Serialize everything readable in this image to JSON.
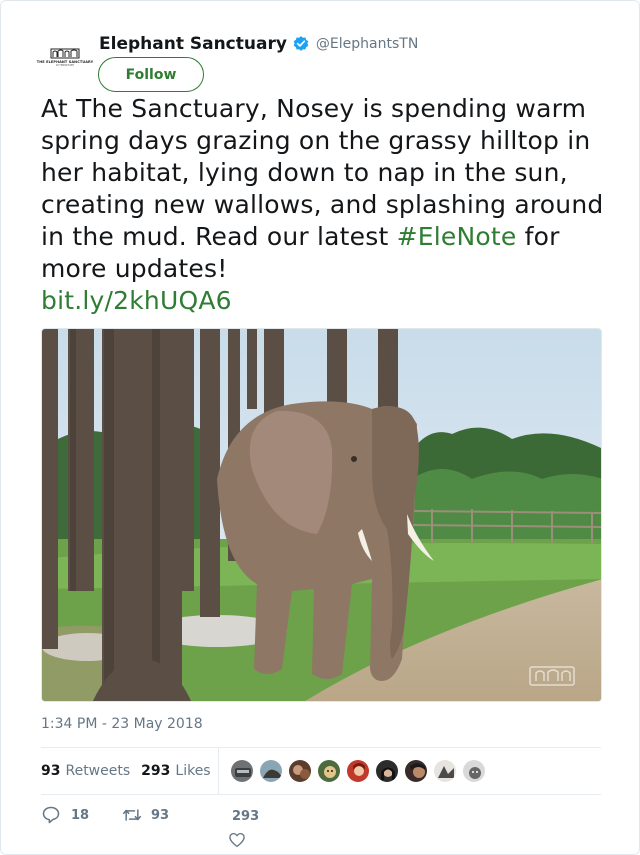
{
  "account": {
    "display_name": "Elephant Sanctuary",
    "handle": "@ElephantsTN",
    "logo_text": "THE ELEPHANT SANCTUARY",
    "logo_subtext": "IN TENNESSEE",
    "verified": true
  },
  "follow_button": {
    "label": "Follow"
  },
  "tweet": {
    "text_main": "At The Sanctuary, Nosey is spending warm spring days grazing on the grassy hilltop in her habitat, lying down to nap in the sun, creating new wallows, and splashing around in the mud. Read our latest ",
    "hashtag": "#EleNote",
    "text_after_hashtag": " for more updates!",
    "link": "bit.ly/2khUQA6"
  },
  "timestamp": "1:34 PM - 23 May 2018",
  "stats": {
    "retweets_count": "93",
    "retweets_label": "Retweets",
    "likes_count": "293",
    "likes_label": "Likes"
  },
  "actions": {
    "reply_count": "18",
    "retweet_count": "93",
    "like_count": "293"
  },
  "colors": {
    "accent_green": "#2e7d32",
    "verified_blue": "#1da1f2",
    "muted_text": "#657786"
  }
}
